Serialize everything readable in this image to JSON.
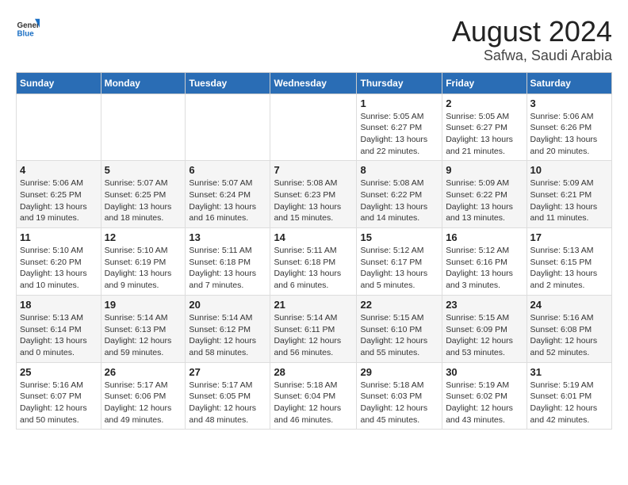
{
  "logo": {
    "text_general": "General",
    "text_blue": "Blue"
  },
  "title": "August 2024",
  "subtitle": "Safwa, Saudi Arabia",
  "days_of_week": [
    "Sunday",
    "Monday",
    "Tuesday",
    "Wednesday",
    "Thursday",
    "Friday",
    "Saturday"
  ],
  "weeks": [
    [
      {
        "day": "",
        "info": ""
      },
      {
        "day": "",
        "info": ""
      },
      {
        "day": "",
        "info": ""
      },
      {
        "day": "",
        "info": ""
      },
      {
        "day": "1",
        "info": "Sunrise: 5:05 AM\nSunset: 6:27 PM\nDaylight: 13 hours and 22 minutes."
      },
      {
        "day": "2",
        "info": "Sunrise: 5:05 AM\nSunset: 6:27 PM\nDaylight: 13 hours and 21 minutes."
      },
      {
        "day": "3",
        "info": "Sunrise: 5:06 AM\nSunset: 6:26 PM\nDaylight: 13 hours and 20 minutes."
      }
    ],
    [
      {
        "day": "4",
        "info": "Sunrise: 5:06 AM\nSunset: 6:25 PM\nDaylight: 13 hours and 19 minutes."
      },
      {
        "day": "5",
        "info": "Sunrise: 5:07 AM\nSunset: 6:25 PM\nDaylight: 13 hours and 18 minutes."
      },
      {
        "day": "6",
        "info": "Sunrise: 5:07 AM\nSunset: 6:24 PM\nDaylight: 13 hours and 16 minutes."
      },
      {
        "day": "7",
        "info": "Sunrise: 5:08 AM\nSunset: 6:23 PM\nDaylight: 13 hours and 15 minutes."
      },
      {
        "day": "8",
        "info": "Sunrise: 5:08 AM\nSunset: 6:22 PM\nDaylight: 13 hours and 14 minutes."
      },
      {
        "day": "9",
        "info": "Sunrise: 5:09 AM\nSunset: 6:22 PM\nDaylight: 13 hours and 13 minutes."
      },
      {
        "day": "10",
        "info": "Sunrise: 5:09 AM\nSunset: 6:21 PM\nDaylight: 13 hours and 11 minutes."
      }
    ],
    [
      {
        "day": "11",
        "info": "Sunrise: 5:10 AM\nSunset: 6:20 PM\nDaylight: 13 hours and 10 minutes."
      },
      {
        "day": "12",
        "info": "Sunrise: 5:10 AM\nSunset: 6:19 PM\nDaylight: 13 hours and 9 minutes."
      },
      {
        "day": "13",
        "info": "Sunrise: 5:11 AM\nSunset: 6:18 PM\nDaylight: 13 hours and 7 minutes."
      },
      {
        "day": "14",
        "info": "Sunrise: 5:11 AM\nSunset: 6:18 PM\nDaylight: 13 hours and 6 minutes."
      },
      {
        "day": "15",
        "info": "Sunrise: 5:12 AM\nSunset: 6:17 PM\nDaylight: 13 hours and 5 minutes."
      },
      {
        "day": "16",
        "info": "Sunrise: 5:12 AM\nSunset: 6:16 PM\nDaylight: 13 hours and 3 minutes."
      },
      {
        "day": "17",
        "info": "Sunrise: 5:13 AM\nSunset: 6:15 PM\nDaylight: 13 hours and 2 minutes."
      }
    ],
    [
      {
        "day": "18",
        "info": "Sunrise: 5:13 AM\nSunset: 6:14 PM\nDaylight: 13 hours and 0 minutes."
      },
      {
        "day": "19",
        "info": "Sunrise: 5:14 AM\nSunset: 6:13 PM\nDaylight: 12 hours and 59 minutes."
      },
      {
        "day": "20",
        "info": "Sunrise: 5:14 AM\nSunset: 6:12 PM\nDaylight: 12 hours and 58 minutes."
      },
      {
        "day": "21",
        "info": "Sunrise: 5:14 AM\nSunset: 6:11 PM\nDaylight: 12 hours and 56 minutes."
      },
      {
        "day": "22",
        "info": "Sunrise: 5:15 AM\nSunset: 6:10 PM\nDaylight: 12 hours and 55 minutes."
      },
      {
        "day": "23",
        "info": "Sunrise: 5:15 AM\nSunset: 6:09 PM\nDaylight: 12 hours and 53 minutes."
      },
      {
        "day": "24",
        "info": "Sunrise: 5:16 AM\nSunset: 6:08 PM\nDaylight: 12 hours and 52 minutes."
      }
    ],
    [
      {
        "day": "25",
        "info": "Sunrise: 5:16 AM\nSunset: 6:07 PM\nDaylight: 12 hours and 50 minutes."
      },
      {
        "day": "26",
        "info": "Sunrise: 5:17 AM\nSunset: 6:06 PM\nDaylight: 12 hours and 49 minutes."
      },
      {
        "day": "27",
        "info": "Sunrise: 5:17 AM\nSunset: 6:05 PM\nDaylight: 12 hours and 48 minutes."
      },
      {
        "day": "28",
        "info": "Sunrise: 5:18 AM\nSunset: 6:04 PM\nDaylight: 12 hours and 46 minutes."
      },
      {
        "day": "29",
        "info": "Sunrise: 5:18 AM\nSunset: 6:03 PM\nDaylight: 12 hours and 45 minutes."
      },
      {
        "day": "30",
        "info": "Sunrise: 5:19 AM\nSunset: 6:02 PM\nDaylight: 12 hours and 43 minutes."
      },
      {
        "day": "31",
        "info": "Sunrise: 5:19 AM\nSunset: 6:01 PM\nDaylight: 12 hours and 42 minutes."
      }
    ]
  ]
}
